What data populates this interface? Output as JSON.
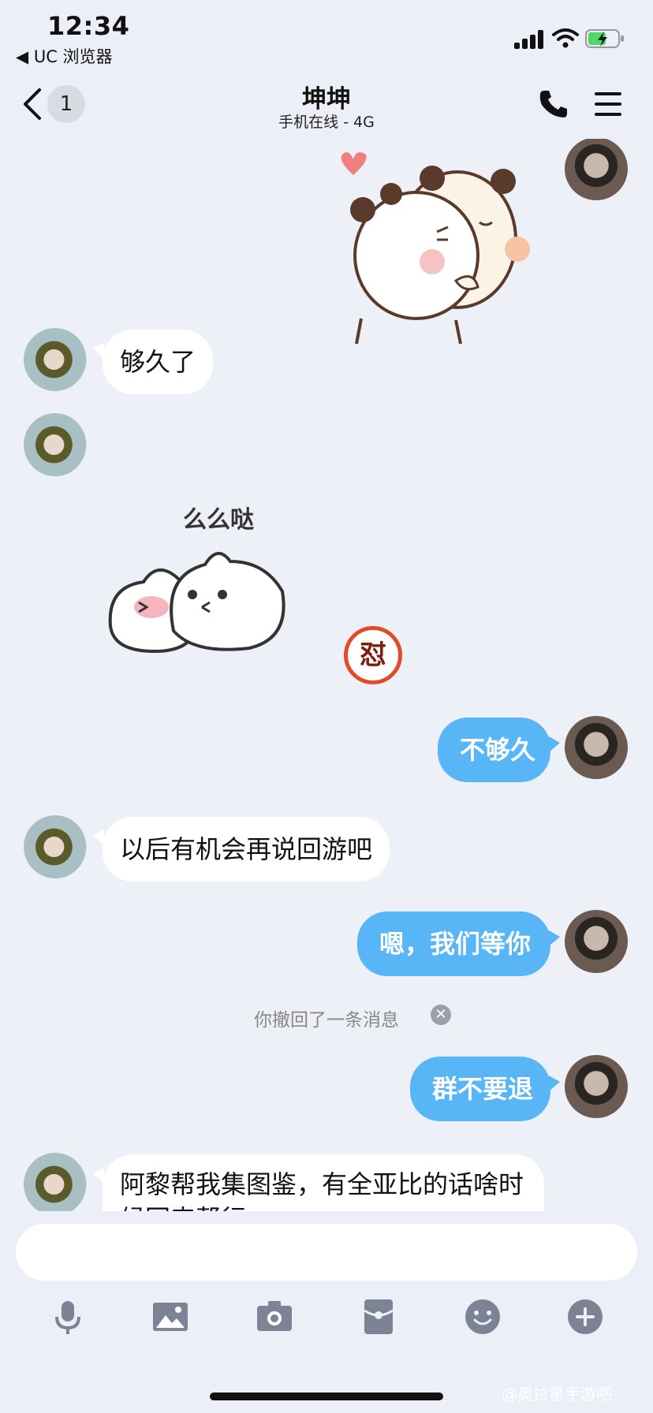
{
  "status_bar": {
    "time": "12:34",
    "back_app": "◀ UC 浏览器",
    "battery_color": "#4cd964"
  },
  "nav": {
    "unread_count": "1",
    "title": "坤坤",
    "subtitle": "手机在线 - 4G"
  },
  "messages": [
    {
      "side": "right",
      "type": "sticker",
      "sticker": "hugging-bears-sticker"
    },
    {
      "side": "left",
      "type": "text",
      "text": "够久了"
    },
    {
      "side": "left",
      "type": "sticker",
      "sticker": "kiss-blobs-sticker",
      "caption": "么么哒"
    },
    {
      "side": "right",
      "type": "text",
      "text": "不够久"
    },
    {
      "side": "left",
      "type": "text",
      "text": "以后有机会再说回游吧"
    },
    {
      "side": "right",
      "type": "text",
      "text": "嗯，我们等你"
    },
    {
      "side": "system",
      "type": "notice",
      "text": "你撤回了一条消息"
    },
    {
      "side": "right",
      "type": "text",
      "text": "群不要退"
    },
    {
      "side": "left",
      "type": "text",
      "text": "阿黎帮我集图鉴，有全亚比的话啥时候回来帮行"
    }
  ],
  "badge_glyph": "怼",
  "input": {
    "placeholder": ""
  },
  "toolbar": [
    "microphone-icon",
    "image-icon",
    "camera-icon",
    "red-packet-icon",
    "emoji-icon",
    "plus-icon"
  ],
  "watermark": "@奥拉星手游吧",
  "colors": {
    "bubble_right": "#58b6f6",
    "bubble_left": "#ffffff",
    "background": "#eef0f8"
  }
}
